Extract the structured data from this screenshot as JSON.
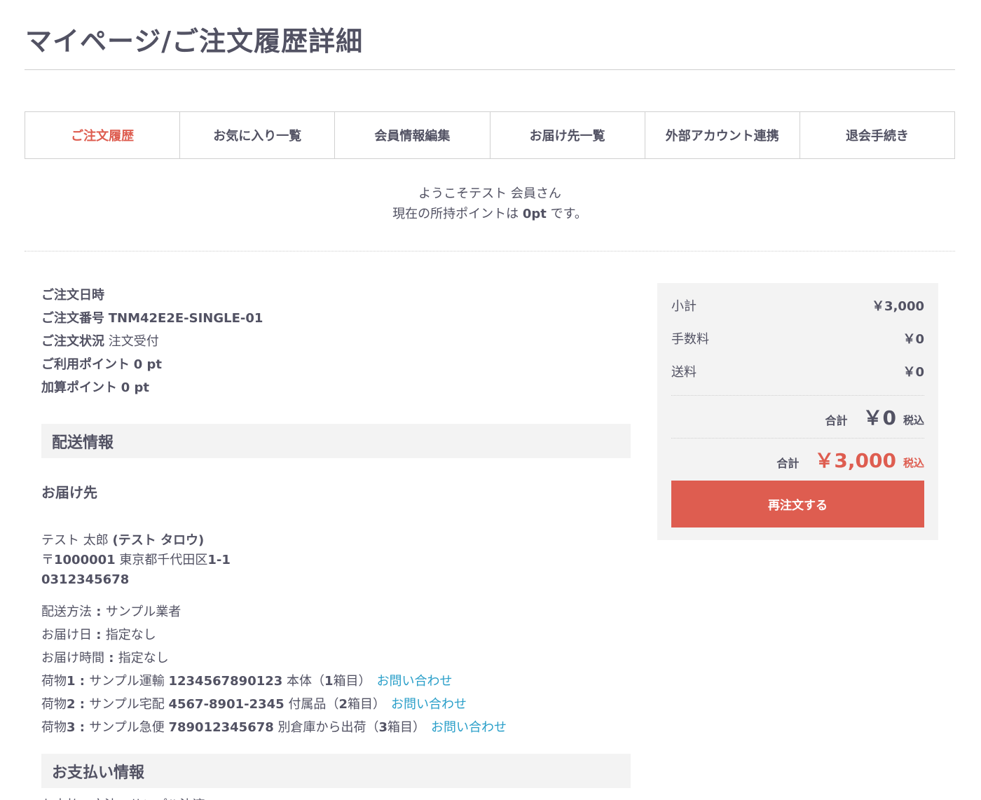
{
  "page": {
    "title": "マイページ/ご注文履歴詳細"
  },
  "nav": {
    "items": [
      {
        "label": "ご注文履歴"
      },
      {
        "label": "お気に入り一覧"
      },
      {
        "label": "会員情報編集"
      },
      {
        "label": "お届け先一覧"
      },
      {
        "label": "外部アカウント連携"
      },
      {
        "label": "退会手続き"
      }
    ],
    "active_color": "#de5d50"
  },
  "welcome": {
    "line1": "ようこそテスト 会員さん",
    "points_prefix": "現在の所持ポイントは ",
    "points_value": "0pt",
    "points_suffix": " です。"
  },
  "order": {
    "date_label": "ご注文日時",
    "date_value": "",
    "number_label": "ご注文番号",
    "number_value": "TNM42E2E-SINGLE-01",
    "status_label": "ご注文状況",
    "status_value": "注文受付",
    "used_points_label": "ご利用ポイント",
    "used_points_value": "0 pt",
    "added_points_label": "加算ポイント",
    "added_points_value": "0 pt"
  },
  "delivery": {
    "section_title": "配送情報",
    "dest_title": "お届け先",
    "name": "テスト 太郎",
    "kana": "(テスト タロウ)",
    "postal_mark": "〒",
    "postal_code": "1000001",
    "address": "東京都千代田区",
    "address_num": "1-1",
    "phone": "0312345678",
    "method_label": "配送方法",
    "method_value": "サンプル業者",
    "date_label": "お届け日",
    "date_value": "指定なし",
    "time_label": "お届け時間",
    "time_value": "指定なし",
    "packages": [
      {
        "prefix": "荷物",
        "num": "1",
        "carrier": "サンプル運輸",
        "tracking": "1234567890123",
        "desc": "本体",
        "box_open": "（",
        "box_num": "1",
        "box_close": "箱目）",
        "link": "お問い合わせ"
      },
      {
        "prefix": "荷物",
        "num": "2",
        "carrier": "サンプル宅配",
        "tracking": "4567-8901-2345",
        "desc": "付属品",
        "box_open": "（",
        "box_num": "2",
        "box_close": "箱目）",
        "link": "お問い合わせ"
      },
      {
        "prefix": "荷物",
        "num": "3",
        "carrier": "サンプル急便",
        "tracking": "789012345678",
        "desc": "別倉庫から出荷",
        "box_open": "（",
        "box_num": "3",
        "box_close": "箱目）",
        "link": "お問い合わせ"
      }
    ],
    "link_color": "#2a9fc9"
  },
  "payment": {
    "section_title": "お支払い情報",
    "method_text": "お支払い方法：サンプル決済"
  },
  "summary": {
    "subtotal_label": "小計",
    "subtotal_value": "￥3,000",
    "fee_label": "手数料",
    "fee_value": "￥0",
    "shipping_label": "送料",
    "shipping_value": "￥0",
    "total1_label": "合計",
    "total1_value": "￥0",
    "total1_tax": "税込",
    "total2_label": "合計",
    "total2_value": "￥3,000",
    "total2_tax": "税込",
    "reorder_label": "再注文する",
    "accent_color": "#de5d50"
  }
}
